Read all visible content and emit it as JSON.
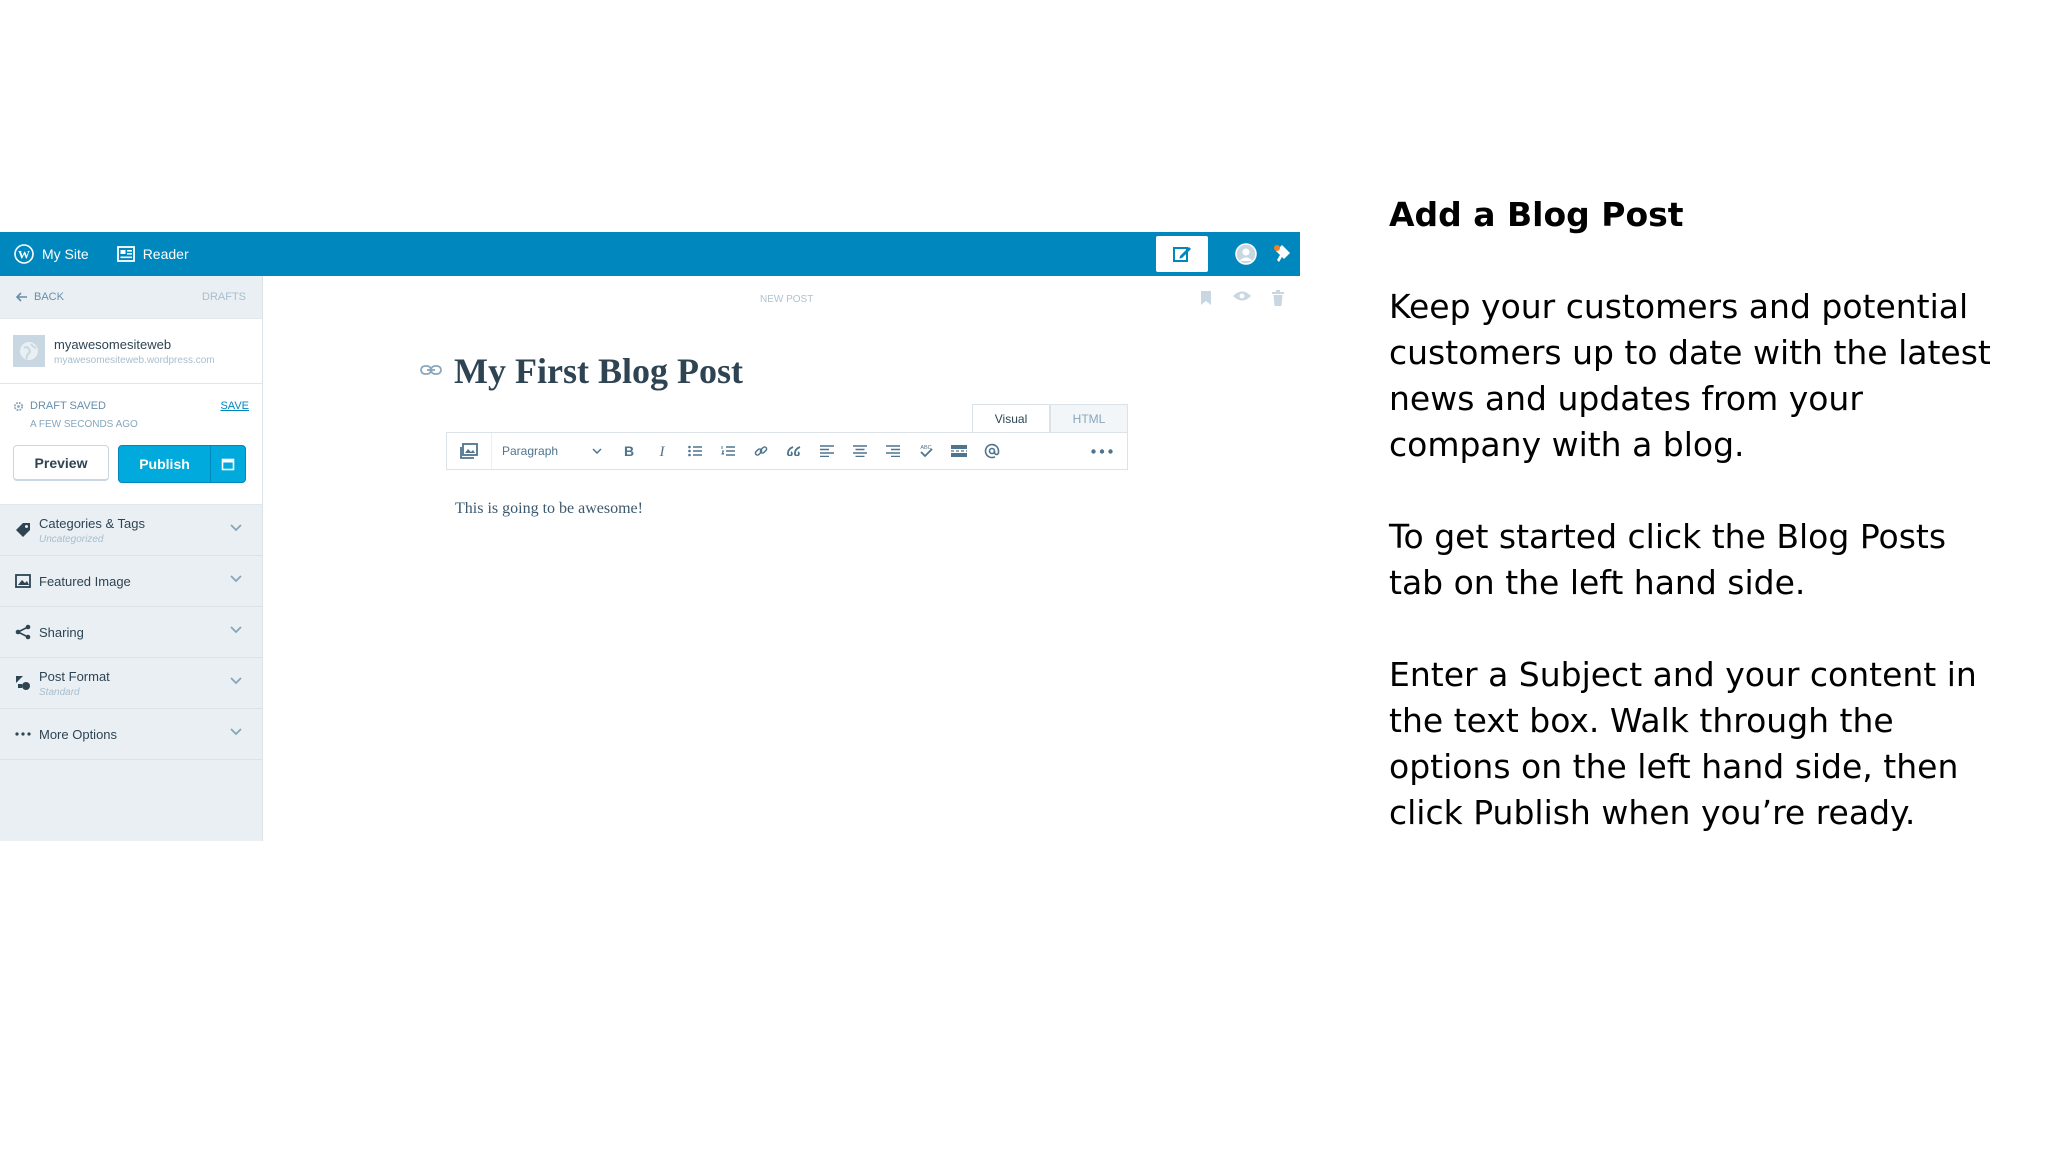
{
  "masterbar": {
    "my_site_label": "My Site",
    "reader_label": "Reader",
    "colors": {
      "bar": "#0087be"
    }
  },
  "sidebar": {
    "back_label": "Back",
    "drafts_label": "Drafts",
    "site_name": "myawesomesiteweb",
    "site_url": "myawesomesiteweb.wordpress.com",
    "status_label": "Draft saved",
    "save_label": "Save",
    "status_time": "A few seconds ago",
    "preview_label": "Preview",
    "publish_label": "Publish",
    "accordions": [
      {
        "title": "Categories & Tags",
        "subtitle": "Uncategorized",
        "icon": "tag-icon"
      },
      {
        "title": "Featured Image",
        "subtitle": "",
        "icon": "image-icon"
      },
      {
        "title": "Sharing",
        "subtitle": "",
        "icon": "share-icon"
      },
      {
        "title": "Post Format",
        "subtitle": "Standard",
        "icon": "shapes-icon"
      },
      {
        "title": "More Options",
        "subtitle": "",
        "icon": "ellipsis-icon"
      }
    ]
  },
  "editor": {
    "header_label": "New Post",
    "title": "My First Blog Post",
    "tab_visual": "Visual",
    "tab_html": "HTML",
    "format_select": "Paragraph",
    "content": "This is going to be awesome!"
  },
  "instructions": {
    "title": "Add a Blog Post",
    "p1": "Keep your customers and potential customers up to date with the latest news and updates from your company with a blog.",
    "p2": "To get started click the Blog Posts tab on the left hand side.",
    "p3": "Enter a Subject and your content in the text box. Walk through the options on the left hand side, then click Publish when you’re ready."
  }
}
